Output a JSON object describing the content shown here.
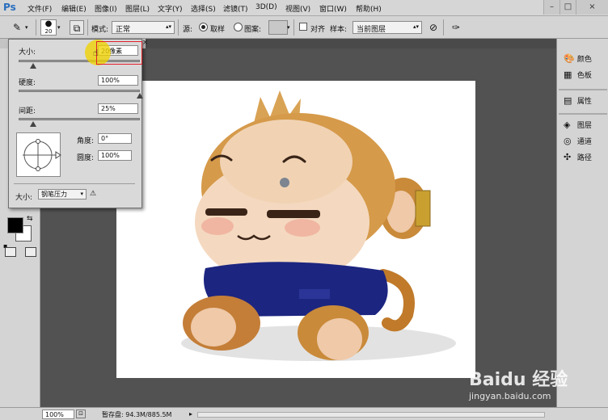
{
  "app": {
    "logo": "Ps"
  },
  "menu": [
    "文件(F)",
    "编辑(E)",
    "图像(I)",
    "图层(L)",
    "文字(Y)",
    "选择(S)",
    "滤镜(T)",
    "3D(D)",
    "视图(V)",
    "窗口(W)",
    "帮助(H)"
  ],
  "window_controls": [
    "–",
    "□",
    "×"
  ],
  "options": {
    "brush_size": "20",
    "mode_label": "模式:",
    "mode_value": "正常",
    "source_label": "源:",
    "radio_sampled": "取样",
    "radio_pattern": "图案:",
    "aligned_label": "对齐",
    "sample_label": "样本:",
    "sample_value": "当前图层"
  },
  "brush_popup": {
    "size_label": "大小:",
    "size_value": "20像素",
    "hardness_label": "硬度:",
    "hardness_value": "100%",
    "spacing_label": "间距:",
    "spacing_value": "25%",
    "angle_label": "角度:",
    "angle_value": "0°",
    "roundness_label": "圆度:",
    "roundness_value": "100%",
    "size_control_label": "大小:",
    "size_control_value": "钢笔压力",
    "size_slider_pos": 0.12,
    "hardness_slider_pos": 1.0,
    "spacing_slider_pos": 0.12
  },
  "right_panel": {
    "items": [
      {
        "label": "颜色",
        "icon": "color-palette-icon"
      },
      {
        "label": "色板",
        "icon": "swatches-icon"
      },
      {
        "label": "属性",
        "icon": "properties-icon"
      },
      {
        "label": "图层",
        "icon": "layers-icon"
      },
      {
        "label": "通道",
        "icon": "channels-icon"
      },
      {
        "label": "路径",
        "icon": "paths-icon"
      }
    ]
  },
  "status": {
    "zoom": "100%",
    "scratch_label": "暂存盘: 94.3M/885.5M"
  },
  "watermark": {
    "brand": "Baidu 经验",
    "url": "jingyan.baidu.com"
  },
  "colors": {
    "highlight": "#e0222a",
    "cursor": "#f0d200",
    "foreground": "#000000",
    "background": "#ffffff"
  }
}
